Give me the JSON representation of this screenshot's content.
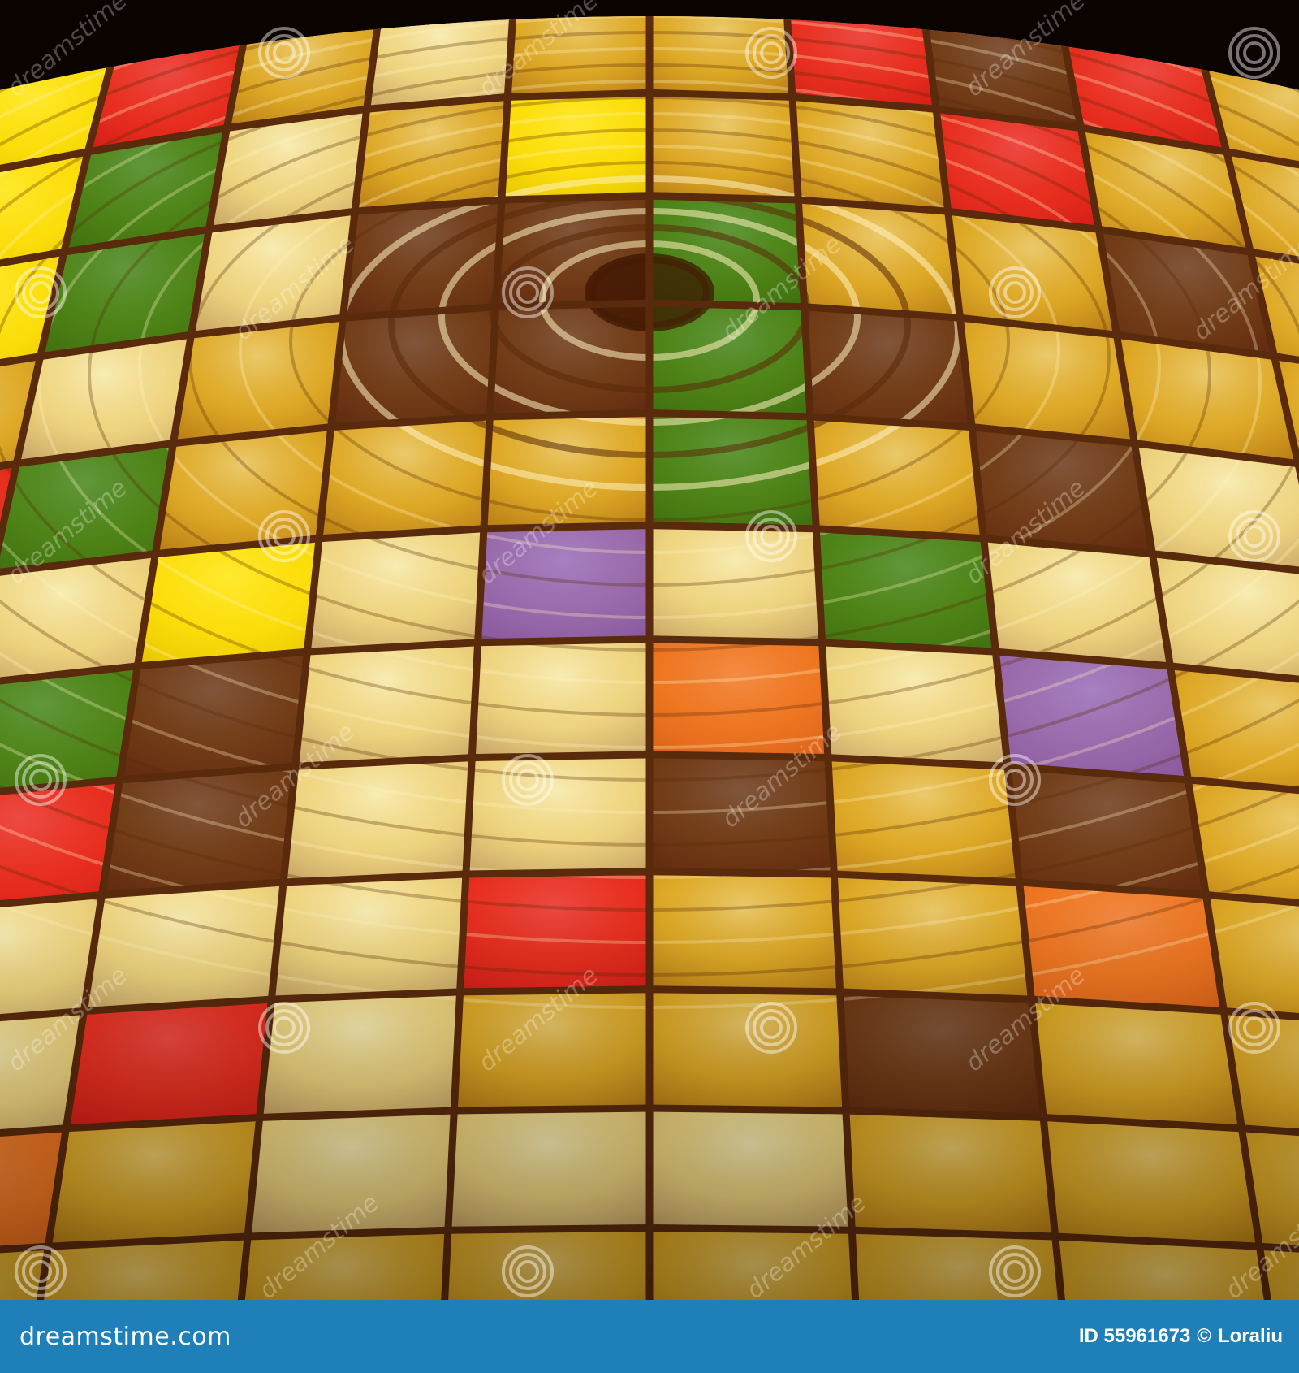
{
  "image": {
    "alt_subject": "abstract swirling ripple pattern behind a grid of colored squares",
    "palette": {
      "gold": "#d9a21b",
      "cream": "#f2e3a0",
      "red": "#e8141a",
      "orange": "#f06a1c",
      "yellow": "#ffe600",
      "green": "#2f7a10",
      "lime": "#8fbf1a",
      "purple": "#8a5cc2",
      "brown": "#5a2410",
      "grid_line": "#5a2a0c"
    }
  },
  "watermark": {
    "text": "dreamstime",
    "icon": "spiral-logo-icon"
  },
  "footer": {
    "site": "dreamstime.com",
    "id_text": "ID 55961673",
    "copyright_symbol": "©",
    "author": "Loraliu",
    "background_color": "#1f7fb8"
  }
}
